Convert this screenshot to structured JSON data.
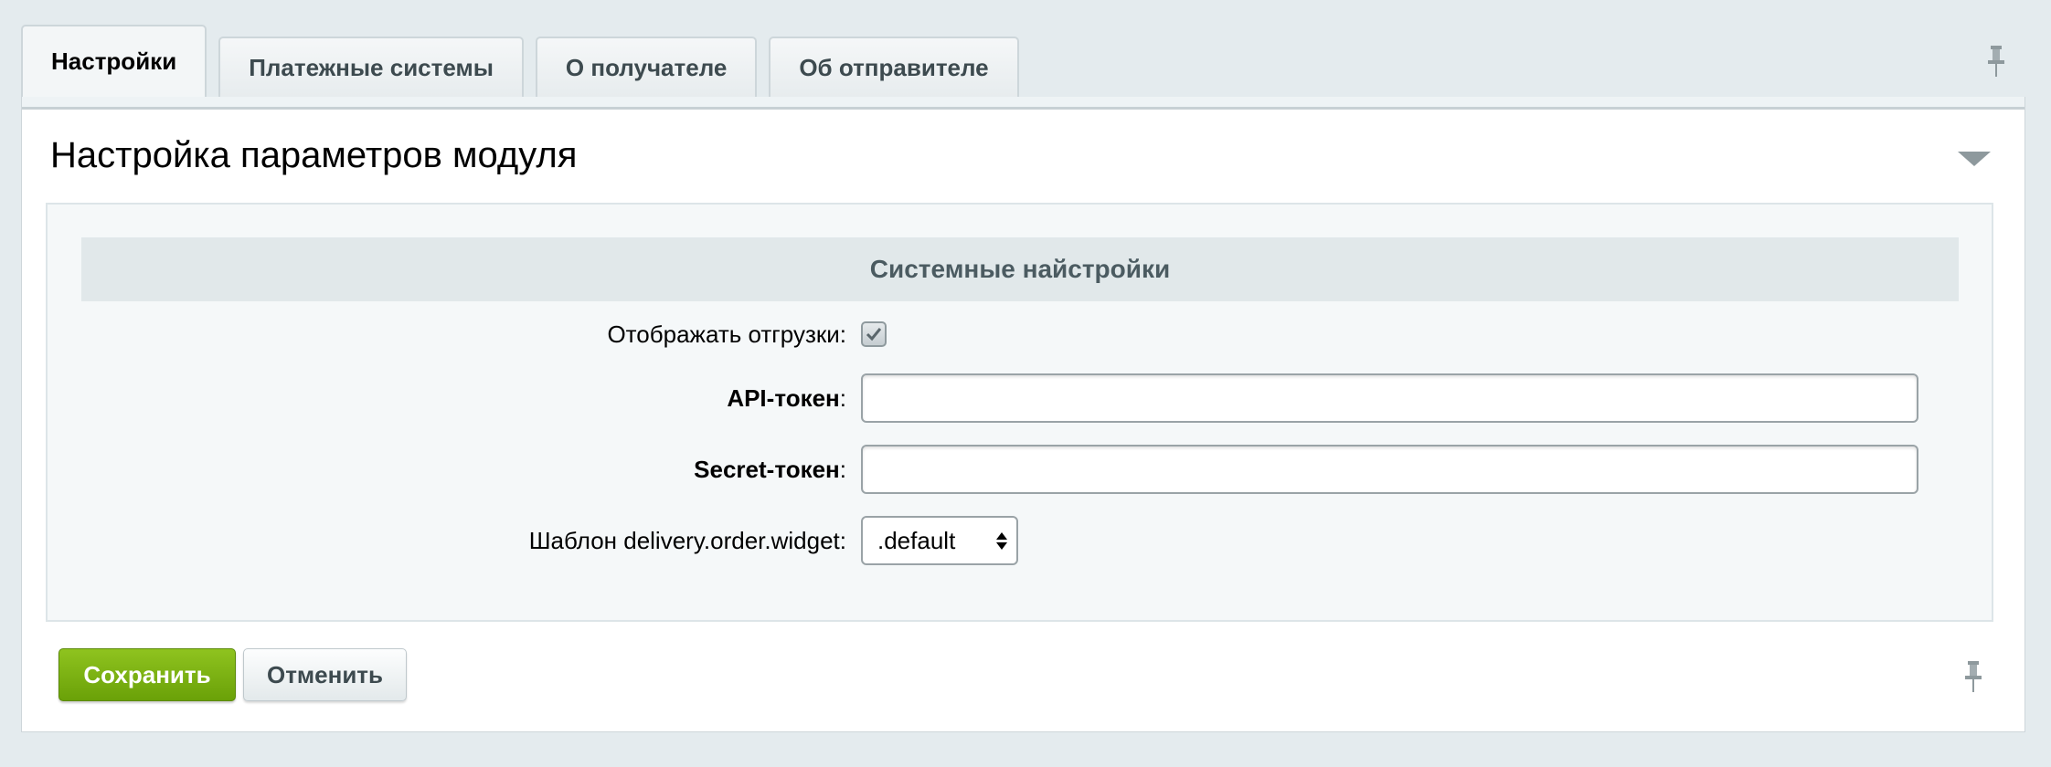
{
  "tabs": [
    {
      "label": "Настройки",
      "active": true
    },
    {
      "label": "Платежные системы",
      "active": false
    },
    {
      "label": "О получателе",
      "active": false
    },
    {
      "label": "Об отправителе",
      "active": false
    }
  ],
  "panel": {
    "title": "Настройка параметров модуля",
    "section_title": "Системные найстройки"
  },
  "form": {
    "show_shipments": {
      "label": "Отображать отгрузки:",
      "checked": true
    },
    "api_token": {
      "label": "API-токен",
      "value": ""
    },
    "secret_token": {
      "label": "Secret-токен",
      "value": ""
    },
    "widget_template": {
      "label": "Шаблон delivery.order.widget:",
      "selected": ".default"
    },
    "colon": ":"
  },
  "buttons": {
    "save": "Сохранить",
    "cancel": "Отменить"
  },
  "icons": {
    "pin": "pin-icon",
    "collapse": "triangle-down-icon",
    "check": "checkmark-icon"
  },
  "colors": {
    "save_button": "#7ab317",
    "background": "#e4ebee"
  }
}
